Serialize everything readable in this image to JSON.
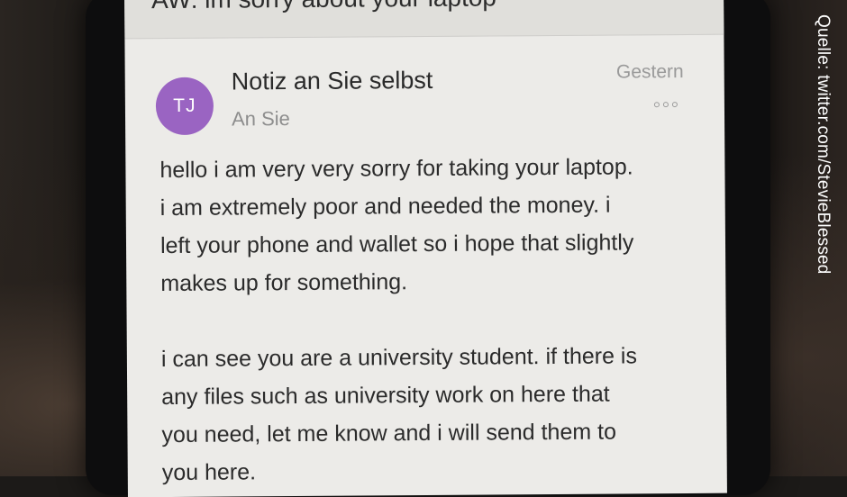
{
  "previous_email": {
    "subject": "AW: im sorry about your laptop"
  },
  "email": {
    "avatar_initials": "TJ",
    "sender": "Notiz an Sie selbst",
    "recipient": "An Sie",
    "date": "Gestern",
    "more_icon": "more-dots-icon",
    "body": [
      {
        "lines": [
          "hello i am very very sorry for taking your laptop.",
          "i am extremely poor and needed the money. i",
          "left your phone and wallet so i hope that slightly",
          "makes up for something."
        ]
      },
      {
        "lines": [
          "i can see you are a university student. if there is",
          "any files such as university work on here that",
          "you need, let me know and i will send them to",
          "you here."
        ]
      }
    ]
  },
  "watermark": "Quelle: twitter.com/StevieBlessed",
  "colors": {
    "avatar": "#9a64c2",
    "screen_background": "#ecebe8",
    "text": "#2b2b2b",
    "secondary_text": "#8d8d8d"
  }
}
